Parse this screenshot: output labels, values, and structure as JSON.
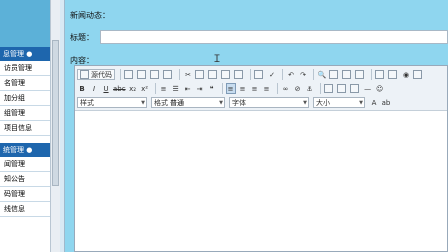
{
  "sidebar": {
    "sections": [
      {
        "header": "息管理 ●",
        "items": [
          "访员管理",
          "名管理",
          "加分组",
          "组管理",
          "项目信息"
        ]
      },
      {
        "header": "统管理 ●",
        "items": [
          "闻管理",
          "知公告",
          "码管理",
          "线信息"
        ]
      }
    ]
  },
  "form": {
    "page_heading": "新闻动态：",
    "title_label": "标题：",
    "title_value": "",
    "content_label": "内容："
  },
  "editor": {
    "source_label": "源代码",
    "bold": "B",
    "italic": "I",
    "underline": "U",
    "strike": "abc",
    "subscript": "x₂",
    "superscript": "x²",
    "style_label": "样式",
    "style_value": "",
    "format_label": "格式",
    "format_value": "普通",
    "font_label": "字体",
    "font_value": "",
    "size_label": "大小",
    "size_value": "",
    "font_color_glyph": "A",
    "bg_color_glyph": "ab",
    "smiley_glyph": "☺"
  },
  "colors": {
    "page_background": "#8fd6ef",
    "sidebar_header": "#1e66ad",
    "sidebar_top": "#5cb1d8"
  }
}
